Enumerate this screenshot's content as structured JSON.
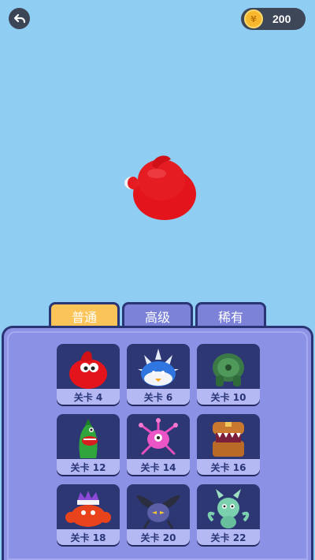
{
  "header": {
    "coins": "200",
    "coin_symbol": "¥"
  },
  "tabs": [
    {
      "label": "普通",
      "active": true
    },
    {
      "label": "高级",
      "active": false
    },
    {
      "label": "稀有",
      "active": false
    }
  ],
  "cards": [
    {
      "label": "关卡 4",
      "creature": "red-blob-icon"
    },
    {
      "label": "关卡 6",
      "creature": "spiky-shell-icon"
    },
    {
      "label": "关卡 10",
      "creature": "green-golem-icon"
    },
    {
      "label": "关卡 12",
      "creature": "green-dino-icon"
    },
    {
      "label": "关卡 14",
      "creature": "pink-spider-icon"
    },
    {
      "label": "关卡 16",
      "creature": "chest-mimic-icon"
    },
    {
      "label": "关卡 18",
      "creature": "crab-king-icon"
    },
    {
      "label": "关卡 20",
      "creature": "dark-bat-icon"
    },
    {
      "label": "关卡 22",
      "creature": "green-dragon-icon"
    }
  ],
  "colors": {
    "sky": "#8fcdf2",
    "panel": "#8e93e6",
    "tab_active": "#fbc459",
    "tab_inactive": "#7c82d8",
    "card_bg": "#2d3773",
    "card_label_bg": "#b4b9f4"
  }
}
